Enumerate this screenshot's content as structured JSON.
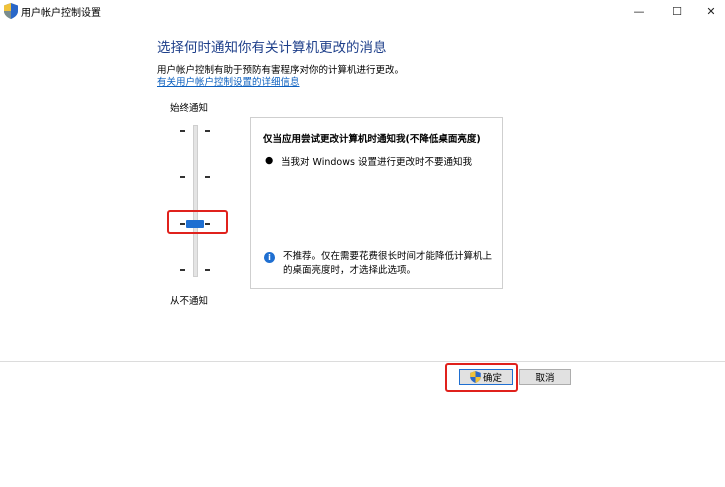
{
  "window": {
    "title": "用户帐户控制设置",
    "minimize_glyph": "—",
    "maximize_glyph": "☐",
    "close_glyph": "✕"
  },
  "header": {
    "heading": "选择何时通知你有关计算机更改的消息",
    "description": "用户帐户控制有助于预防有害程序对你的计算机进行更改。",
    "link": "有关用户帐户控制设置的详细信息"
  },
  "slider": {
    "top_label": "始终通知",
    "bottom_label": "从不通知",
    "levels": 4,
    "selected_level": 2
  },
  "info": {
    "title": "仅当应用尝试更改计算机时通知我(不降低桌面亮度)",
    "bullet": "当我对 Windows 设置进行更改时不要通知我",
    "icon_glyph": "i",
    "note": "不推荐。仅在需要花费很长时间才能降低计算机上的桌面亮度时，才选择此选项。"
  },
  "buttons": {
    "ok": "确定",
    "cancel": "取消"
  },
  "colors": {
    "accent": "#1f6fd1",
    "heading": "#1e3f8a",
    "highlight": "#e0211c"
  }
}
